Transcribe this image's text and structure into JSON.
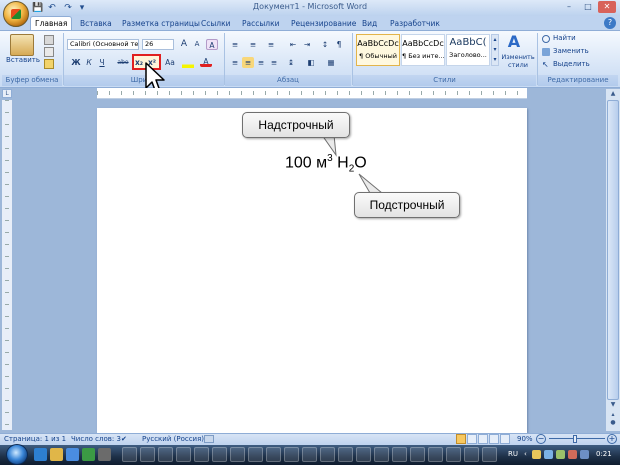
{
  "window": {
    "title": "Документ1 - Microsoft Word",
    "minimize": "–",
    "maximize": "□",
    "close": "✕",
    "help": "?"
  },
  "qat": {
    "save": "💾",
    "undo": "↶",
    "redo": "↷",
    "more": "▾"
  },
  "tabs": [
    {
      "label": "Главная",
      "active": true
    },
    {
      "label": "Вставка"
    },
    {
      "label": "Разметка страницы"
    },
    {
      "label": "Ссылки"
    },
    {
      "label": "Рассылки"
    },
    {
      "label": "Рецензирование"
    },
    {
      "label": "Вид"
    },
    {
      "label": "Разработчик"
    }
  ],
  "ribbon": {
    "clipboard": {
      "paste_label": "Вставить",
      "group": "Буфер обмена"
    },
    "font": {
      "font_name": "Calibri (Основной те",
      "font_size": "26",
      "grow": "A",
      "shrink": "A",
      "clear": "A",
      "bold": "Ж",
      "italic": "К",
      "underline": "Ч",
      "strike": "abe",
      "subscript": "x₂",
      "superscript": "x²",
      "case": "Aa",
      "color": "A",
      "group": "Шрифт"
    },
    "paragraph": {
      "group": "Абзац"
    },
    "styles": {
      "items": [
        {
          "sample": "AaBbCcDc",
          "name": "¶ Обычный"
        },
        {
          "sample": "AaBbCcDc",
          "name": "¶ Без инте..."
        },
        {
          "sample": "AaBbC(",
          "name": "Заголово..."
        }
      ],
      "change_label": "Изменить стили",
      "group": "Стили"
    },
    "editing": {
      "find": "Найти",
      "replace": "Заменить",
      "select": "Выделить",
      "group": "Редактирование"
    }
  },
  "document": {
    "formula": {
      "number": "100",
      "unit": "м",
      "sup": "3",
      "h": "H",
      "sub": "2",
      "o": "O"
    },
    "callout_super": "Надстрочный",
    "callout_sub": "Подстрочный"
  },
  "status": {
    "page": "Страница: 1 из 1",
    "words": "Число слов: 3",
    "language": "Русский (Россия)",
    "zoom": "90%"
  },
  "taskbar": {
    "lang": "RU",
    "time": "0:21"
  },
  "colors": {
    "highlight_red": "#e02020",
    "ribbon_blue": "#15428b"
  }
}
